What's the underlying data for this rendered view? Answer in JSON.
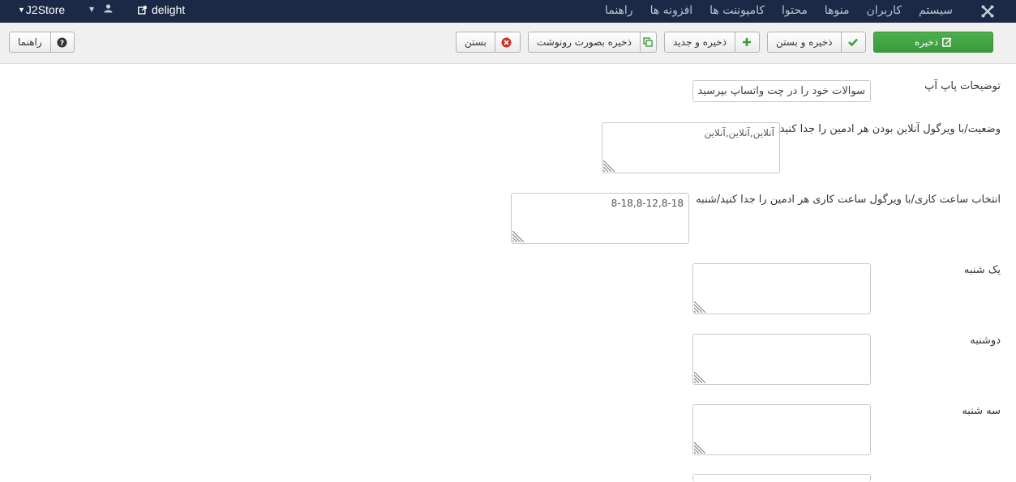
{
  "navbar": {
    "brand": "J2Store",
    "site_name": "delight",
    "menu": [
      "سیستم",
      "کاربران",
      "منوها",
      "محتوا",
      "کامپوننت ها",
      "افزونه ها",
      "راهنما"
    ]
  },
  "toolbar": {
    "save": "ذخیره",
    "save_close": "ذخیره و بستن",
    "save_new": "ذخیره و جدید",
    "save_copy": "ذخیره بصورت رونوشت",
    "close": "بستن",
    "help": "راهنما"
  },
  "form": {
    "popup_desc_label": "توضیحات پاپ آپ",
    "popup_desc_value": "سوالات خود را در چت واتساپ بپرسید",
    "status_label": "وضعیت/با ویرگول آنلاین بودن هر ادمین را جدا کنید",
    "status_value": "آنلاین,آنلاین,آنلاین",
    "hours_label": "انتخاب ساعت کاری/با ویرگول ساعت کاری هر ادمین را جدا کنید/شنبه",
    "hours_value": "8-18,8-12,8-18",
    "sunday_label": "یک شنبه",
    "sunday_value": "",
    "monday_label": "دوشنبه",
    "monday_value": "",
    "tuesday_label": "سه شنبه",
    "tuesday_value": ""
  },
  "colors": {
    "navbar_bg": "#1a2946",
    "save_green": "#3a9a3a",
    "close_red": "#c9302c"
  }
}
